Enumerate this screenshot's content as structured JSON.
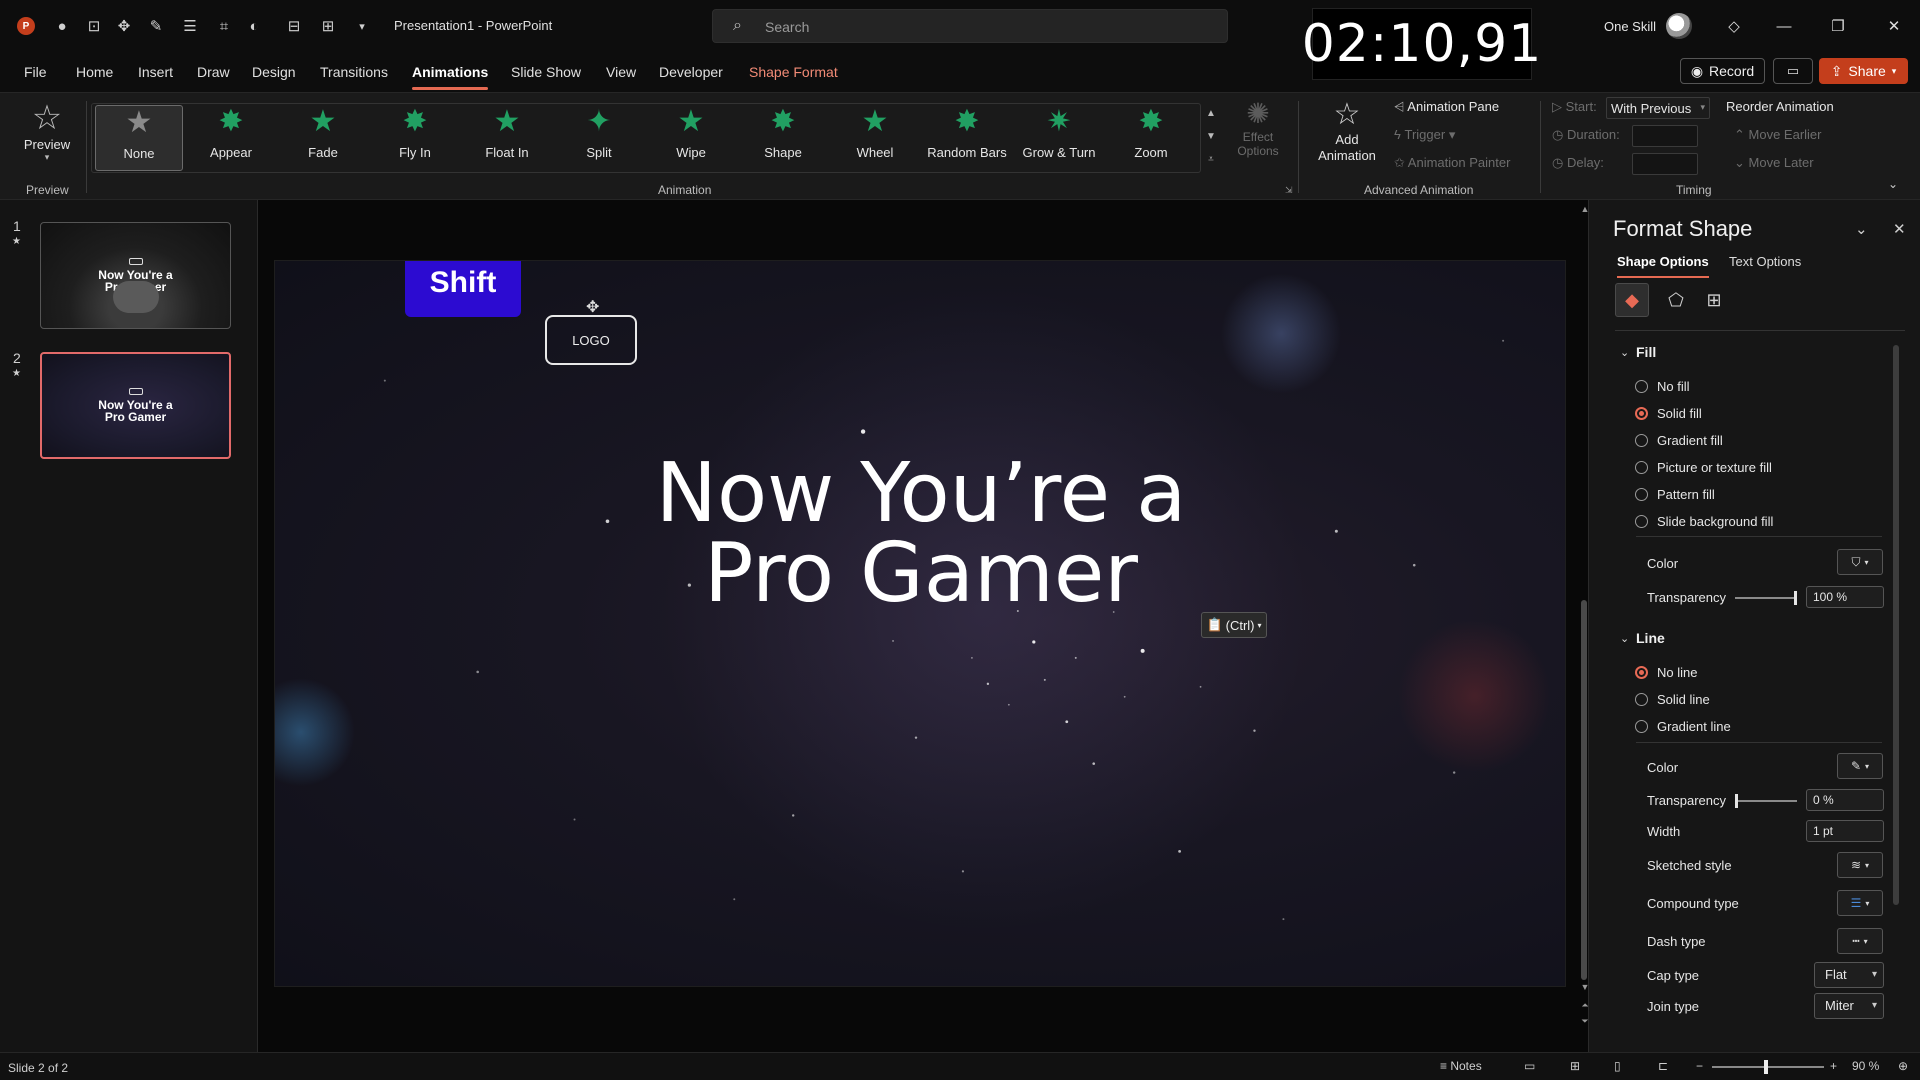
{
  "titlebar": {
    "app_icon": "powerpoint-icon",
    "app_letter": "P",
    "quick_access": [
      "autosave-icon",
      "screenshot-icon",
      "move-icon",
      "pen-icon",
      "paragraph-icon",
      "crop-icon",
      "shapes-icon",
      "align-icon",
      "distribute-icon",
      "customize-icon"
    ],
    "doc_title": "Presentation1  -  PowerPoint",
    "search_placeholder": "Search",
    "timer": "02:10,91",
    "user_name": "One Skill",
    "window_buttons": [
      "minimize",
      "restore",
      "close"
    ]
  },
  "tabs": [
    {
      "label": "File"
    },
    {
      "label": "Home"
    },
    {
      "label": "Insert"
    },
    {
      "label": "Draw"
    },
    {
      "label": "Design"
    },
    {
      "label": "Transitions"
    },
    {
      "label": "Animations",
      "active": true
    },
    {
      "label": "Slide Show"
    },
    {
      "label": "View"
    },
    {
      "label": "Developer"
    },
    {
      "label": "Shape Format",
      "contextual": true
    }
  ],
  "actions": {
    "record": "Record",
    "share": "Share"
  },
  "ribbon": {
    "preview_label": "Preview",
    "preview_group": "Preview",
    "animation_group": "Animation",
    "animations": [
      {
        "label": "None",
        "selected": true
      },
      {
        "label": "Appear"
      },
      {
        "label": "Fade"
      },
      {
        "label": "Fly In"
      },
      {
        "label": "Float In"
      },
      {
        "label": "Split"
      },
      {
        "label": "Wipe"
      },
      {
        "label": "Shape"
      },
      {
        "label": "Wheel"
      },
      {
        "label": "Random Bars"
      },
      {
        "label": "Grow & Turn"
      },
      {
        "label": "Zoom"
      }
    ],
    "effect_options": "Effect Options",
    "add_animation": "Add Animation",
    "animation_pane": "Animation Pane",
    "trigger": "Trigger",
    "animation_painter": "Animation Painter",
    "advanced_group": "Advanced Animation",
    "start_label": "Start:",
    "start_value": "With Previous",
    "duration_label": "Duration:",
    "delay_label": "Delay:",
    "reorder": "Reorder Animation",
    "move_earlier": "Move Earlier",
    "move_later": "Move Later",
    "timing_group": "Timing"
  },
  "thumbnails": [
    {
      "number": "1",
      "title_line1": "Now You're a",
      "title_line2": "Pro Gamer"
    },
    {
      "number": "2",
      "title_line1": "Now You're a",
      "title_line2": "Pro Gamer",
      "selected": true
    }
  ],
  "slide": {
    "shift_label": "Shift",
    "logo_label": "LOGO",
    "title_line1": "Now You’re a",
    "title_line2": "Pro Gamer",
    "paste_options": "(Ctrl)"
  },
  "format_pane": {
    "title": "Format Shape",
    "tab_shape": "Shape Options",
    "tab_text": "Text Options",
    "fill_section": "Fill",
    "fill_options": [
      "No fill",
      "Solid fill",
      "Gradient fill",
      "Picture or texture fill",
      "Pattern fill",
      "Slide background fill"
    ],
    "fill_selected": 1,
    "fill_color_label": "Color",
    "fill_transparency_label": "Transparency",
    "fill_transparency_value": "100 %",
    "fill_transparency_fraction": 1.0,
    "line_section": "Line",
    "line_options": [
      "No line",
      "Solid line",
      "Gradient line"
    ],
    "line_selected": 0,
    "line_color_label": "Color",
    "line_transparency_label": "Transparency",
    "line_transparency_value": "0 %",
    "line_transparency_fraction": 0.0,
    "width_label": "Width",
    "width_value": "1 pt",
    "sketched_label": "Sketched style",
    "compound_label": "Compound type",
    "dash_label": "Dash type",
    "cap_label": "Cap type",
    "cap_value": "Flat",
    "join_label": "Join type",
    "join_value": "Miter"
  },
  "statusbar": {
    "slide_count": "Slide 2 of 2",
    "notes": "Notes",
    "zoom": "90 %"
  },
  "colors": {
    "accent": "#e56a52",
    "share": "#c43e1c",
    "shift_button": "#2c0bd1",
    "animation_star": "#21a062"
  }
}
